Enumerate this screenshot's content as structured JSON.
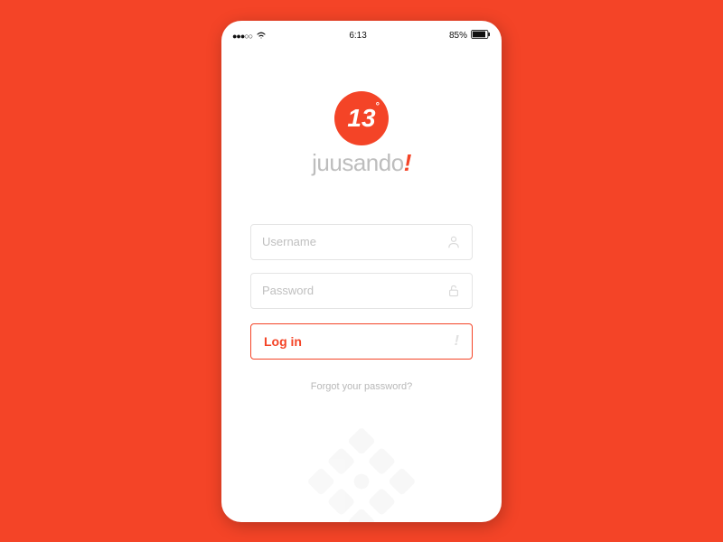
{
  "status_bar": {
    "signal_dots": "●●●○○",
    "time": "6:13",
    "battery_pct": "85%"
  },
  "logo": {
    "circle_text": "13",
    "degree": "°",
    "brand_text": "juusando",
    "brand_bang": "!"
  },
  "fields": {
    "username_placeholder": "Username",
    "password_placeholder": "Password"
  },
  "login": {
    "label": "Log in",
    "bang": "!"
  },
  "forgot_label": "Forgot your password?"
}
